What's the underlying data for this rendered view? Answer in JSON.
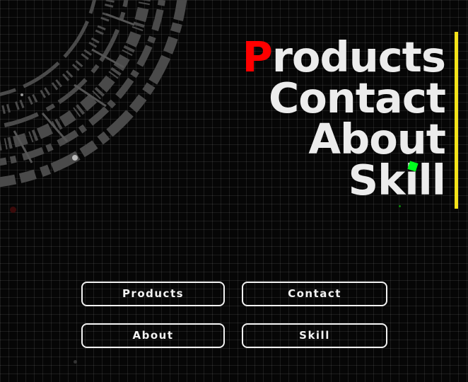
{
  "hero_nav": {
    "products": {
      "first": "P",
      "rest": "roducts"
    },
    "contact": "Contact",
    "about": "About",
    "skill": "Skill"
  },
  "buttons": {
    "products": "Products",
    "contact": "Contact",
    "about": "About",
    "skill": "Skill"
  },
  "colors": {
    "background": "#060606",
    "accent_red": "#ff0000",
    "accent_yellow": "#f5e31a",
    "accent_green": "#00ff1e",
    "text": "#ececec"
  }
}
